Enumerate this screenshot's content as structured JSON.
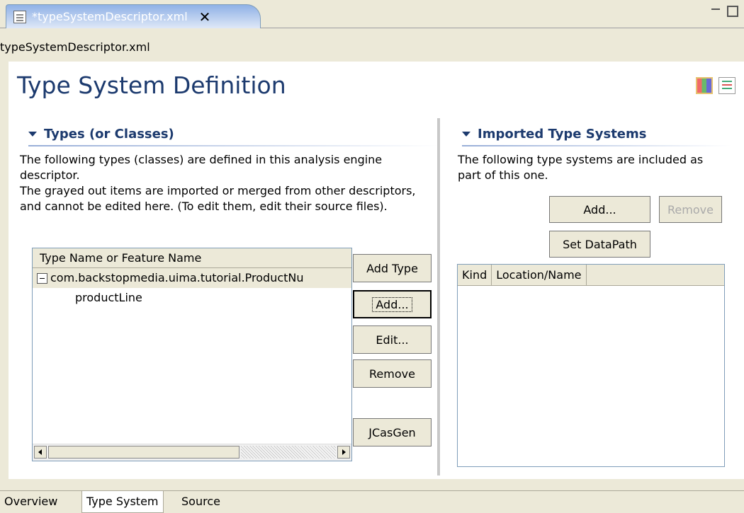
{
  "editor_tab": {
    "label": "*typeSystemDescriptor.xml",
    "close": "✕"
  },
  "file_path": "typeSystemDescriptor.xml",
  "form_title": "Type System Definition",
  "types_section": {
    "title": "Types (or Classes)",
    "description_1": "The following types (classes) are defined in this analysis engine descriptor.",
    "description_2": "The grayed out items are imported or merged from other descriptors, and cannot be edited here. (To edit them, edit their source files).",
    "table_header": "Type Name or Feature Name",
    "rows": [
      {
        "label": "com.backstopmedia.uima.tutorial.ProductNu"
      },
      {
        "label": "productLine"
      }
    ],
    "buttons": {
      "add_type": "Add Type",
      "add": "Add...",
      "edit": "Edit...",
      "remove": "Remove",
      "jcasgen": "JCasGen"
    }
  },
  "imported_section": {
    "title": "Imported Type Systems",
    "description": "The following type systems are included as part of this one.",
    "buttons": {
      "add": "Add...",
      "remove": "Remove",
      "set_datapath": "Set DataPath"
    },
    "columns": [
      "Kind",
      "Location/Name"
    ]
  },
  "bottom_tabs": [
    "Overview",
    "Type System",
    "Source"
  ],
  "active_bottom_tab": "Type System"
}
